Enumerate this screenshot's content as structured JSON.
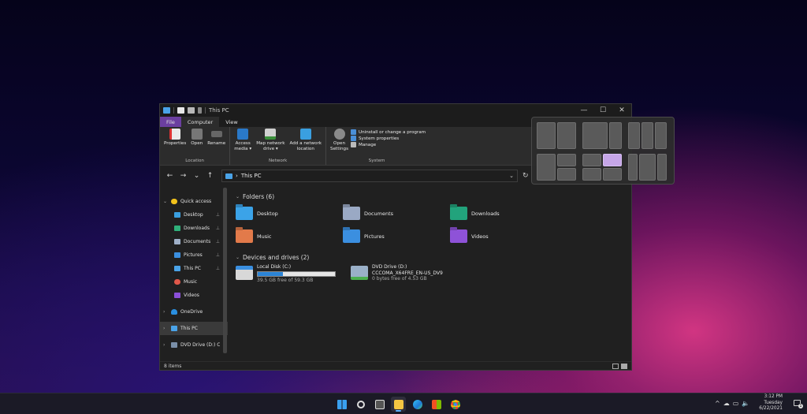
{
  "window": {
    "title": "This PC",
    "controls": {
      "minimize": "—",
      "maximize": "☐",
      "close": "✕"
    }
  },
  "tabs": [
    {
      "label": "File"
    },
    {
      "label": "Computer"
    },
    {
      "label": "View"
    }
  ],
  "ribbon": {
    "groups": [
      {
        "label": "Location",
        "buttons": [
          "Properties",
          "Open",
          "Rename"
        ]
      },
      {
        "label": "Network",
        "buttons": [
          "Access\nmedia ▾",
          "Map network\ndrive ▾",
          "Add a network\nlocation"
        ]
      },
      {
        "label": "System",
        "buttons": [
          "Open\nSettings"
        ],
        "small": [
          "Uninstall or change a program",
          "System properties",
          "Manage"
        ]
      }
    ]
  },
  "nav": {
    "back": "←",
    "forward": "→",
    "recent": "⌄",
    "up": "↑",
    "address": "This PC",
    "address_sep": "›",
    "dropdown": "⌄",
    "refresh": "↻"
  },
  "sidebar": {
    "items": [
      {
        "label": "Quick access",
        "arrow": "⌄"
      },
      {
        "label": "Desktop",
        "pin": "📌"
      },
      {
        "label": "Downloads",
        "pin": "📌"
      },
      {
        "label": "Documents",
        "pin": "📌"
      },
      {
        "label": "Pictures",
        "pin": "📌"
      },
      {
        "label": "This PC",
        "pin": "📌"
      },
      {
        "label": "Music"
      },
      {
        "label": "Videos"
      },
      {
        "label": "OneDrive",
        "arrow": "›"
      },
      {
        "label": "This PC",
        "arrow": "›"
      },
      {
        "label": "DVD Drive (D:) CC",
        "arrow": "›"
      }
    ]
  },
  "folders_section": {
    "title": "Folders (6)",
    "caret": "⌄",
    "items": [
      {
        "label": "Desktop"
      },
      {
        "label": "Documents"
      },
      {
        "label": "Downloads"
      },
      {
        "label": "Music"
      },
      {
        "label": "Pictures"
      },
      {
        "label": "Videos"
      }
    ]
  },
  "drives_section": {
    "title": "Devices and drives (2)",
    "caret": "⌄",
    "drives": [
      {
        "name": "Local Disk (C:)",
        "label2": "",
        "free": "39.5 GB free of 59.3 GB",
        "used_fraction": 0.33
      },
      {
        "name": "DVD Drive (D:)",
        "label2": "CCCOMA_X64FRE_EN-US_DV9",
        "free": "0 bytes free of 4.53 GB"
      }
    ]
  },
  "status": {
    "items": "8 items"
  },
  "taskbar": {
    "tray_chevron": "^",
    "time": "3:12 PM",
    "day": "Tuesday",
    "date": "6/22/2021",
    "notifications": "1"
  },
  "colors": {
    "accent": "#6b3fa0",
    "snap_highlight": "#c6a6e8",
    "drive_fill": "#2b84d6"
  }
}
